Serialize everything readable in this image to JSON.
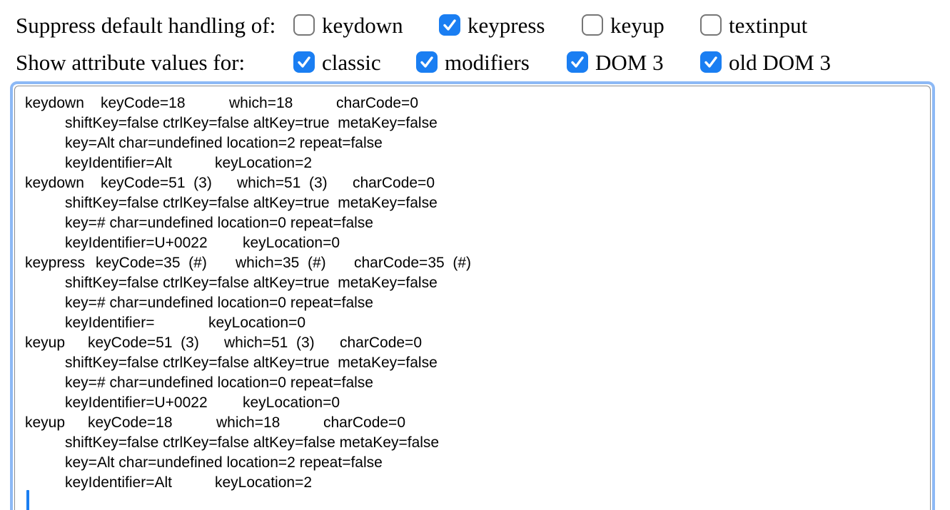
{
  "suppress": {
    "label": "Suppress default handling of:",
    "options": [
      {
        "label": "keydown",
        "checked": false
      },
      {
        "label": "keypress",
        "checked": true
      },
      {
        "label": "keyup",
        "checked": false
      },
      {
        "label": "textinput",
        "checked": false
      }
    ]
  },
  "show": {
    "label": "Show attribute values for:",
    "options": [
      {
        "label": "classic",
        "checked": true
      },
      {
        "label": "modifiers",
        "checked": true
      },
      {
        "label": "DOM 3",
        "checked": true
      },
      {
        "label": "old DOM 3",
        "checked": true
      }
    ]
  },
  "colors": {
    "checkbox_checked": "#1a7ef2",
    "focus_ring": "#8db9f5",
    "caret": "#1a7ef2"
  },
  "icons": {
    "checked": "checkmark-icon"
  },
  "log": [
    {
      "event": "keydown",
      "classic": [
        "keyCode=18",
        "which=18",
        "charCode=0"
      ],
      "modifiers": "shiftKey=false ctrlKey=false altKey=true  metaKey=false",
      "dom3": "key=Alt char=undefined location=2 repeat=false",
      "old_dom3": [
        "keyIdentifier=Alt",
        "keyLocation=2"
      ]
    },
    {
      "event": "keydown",
      "classic": [
        "keyCode=51  (3)",
        "which=51  (3)",
        "charCode=0"
      ],
      "modifiers": "shiftKey=false ctrlKey=false altKey=true  metaKey=false",
      "dom3": "key=# char=undefined location=0 repeat=false",
      "old_dom3": [
        "keyIdentifier=U+0022",
        "keyLocation=0"
      ]
    },
    {
      "event": "keypress",
      "classic": [
        "keyCode=35  (#)",
        "which=35  (#)",
        "charCode=35  (#)"
      ],
      "modifiers": "shiftKey=false ctrlKey=false altKey=true  metaKey=false",
      "dom3": "key=# char=undefined location=0 repeat=false",
      "old_dom3": [
        "keyIdentifier=",
        "keyLocation=0"
      ]
    },
    {
      "event": "keyup",
      "classic": [
        "keyCode=51  (3)",
        "which=51  (3)",
        "charCode=0"
      ],
      "modifiers": "shiftKey=false ctrlKey=false altKey=true  metaKey=false",
      "dom3": "key=# char=undefined location=0 repeat=false",
      "old_dom3": [
        "keyIdentifier=U+0022",
        "keyLocation=0"
      ]
    },
    {
      "event": "keyup",
      "classic": [
        "keyCode=18",
        "which=18",
        "charCode=0"
      ],
      "modifiers": "shiftKey=false ctrlKey=false altKey=false metaKey=false",
      "dom3": "key=Alt char=undefined location=2 repeat=false",
      "old_dom3": [
        "keyIdentifier=Alt",
        "keyLocation=2"
      ]
    }
  ]
}
